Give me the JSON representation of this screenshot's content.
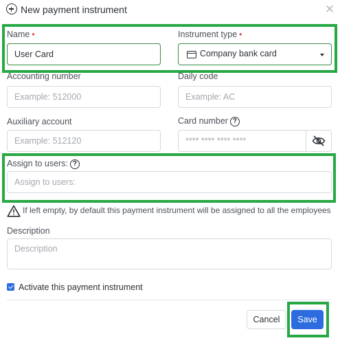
{
  "dialog": {
    "title": "New payment instrument",
    "close_symbol": "✕"
  },
  "form": {
    "name": {
      "label": "Name",
      "required_mark": "•",
      "value": "User Card"
    },
    "instrument_type": {
      "label": "Instrument type",
      "required_mark": "•",
      "value": "Company bank card",
      "icon": "card-icon"
    },
    "accounting_number": {
      "label": "Accounting number",
      "placeholder": "Example: 512000"
    },
    "daily_code": {
      "label": "Daily code",
      "placeholder": "Example: AC"
    },
    "auxiliary_account": {
      "label": "Auxiliary account",
      "placeholder": "Example: 512120"
    },
    "card_number": {
      "label": "Card number",
      "placeholder": "**** **** **** ****",
      "help_symbol": "?"
    },
    "assign_to_users": {
      "label": "Assign to users:",
      "placeholder": "Assign to users:",
      "help_symbol": "?"
    },
    "warning": {
      "text": "If left empty, by default this payment instrument will be assigned to all the employees"
    },
    "description": {
      "label": "Description",
      "placeholder": "Description"
    },
    "activate": {
      "label": "Activate this payment instrument",
      "checked": true
    }
  },
  "footer": {
    "cancel_label": "Cancel",
    "save_label": "Save"
  },
  "colors": {
    "accent": "#2d6cdf",
    "highlight_box": "#27a844",
    "required": "#e0383e"
  }
}
